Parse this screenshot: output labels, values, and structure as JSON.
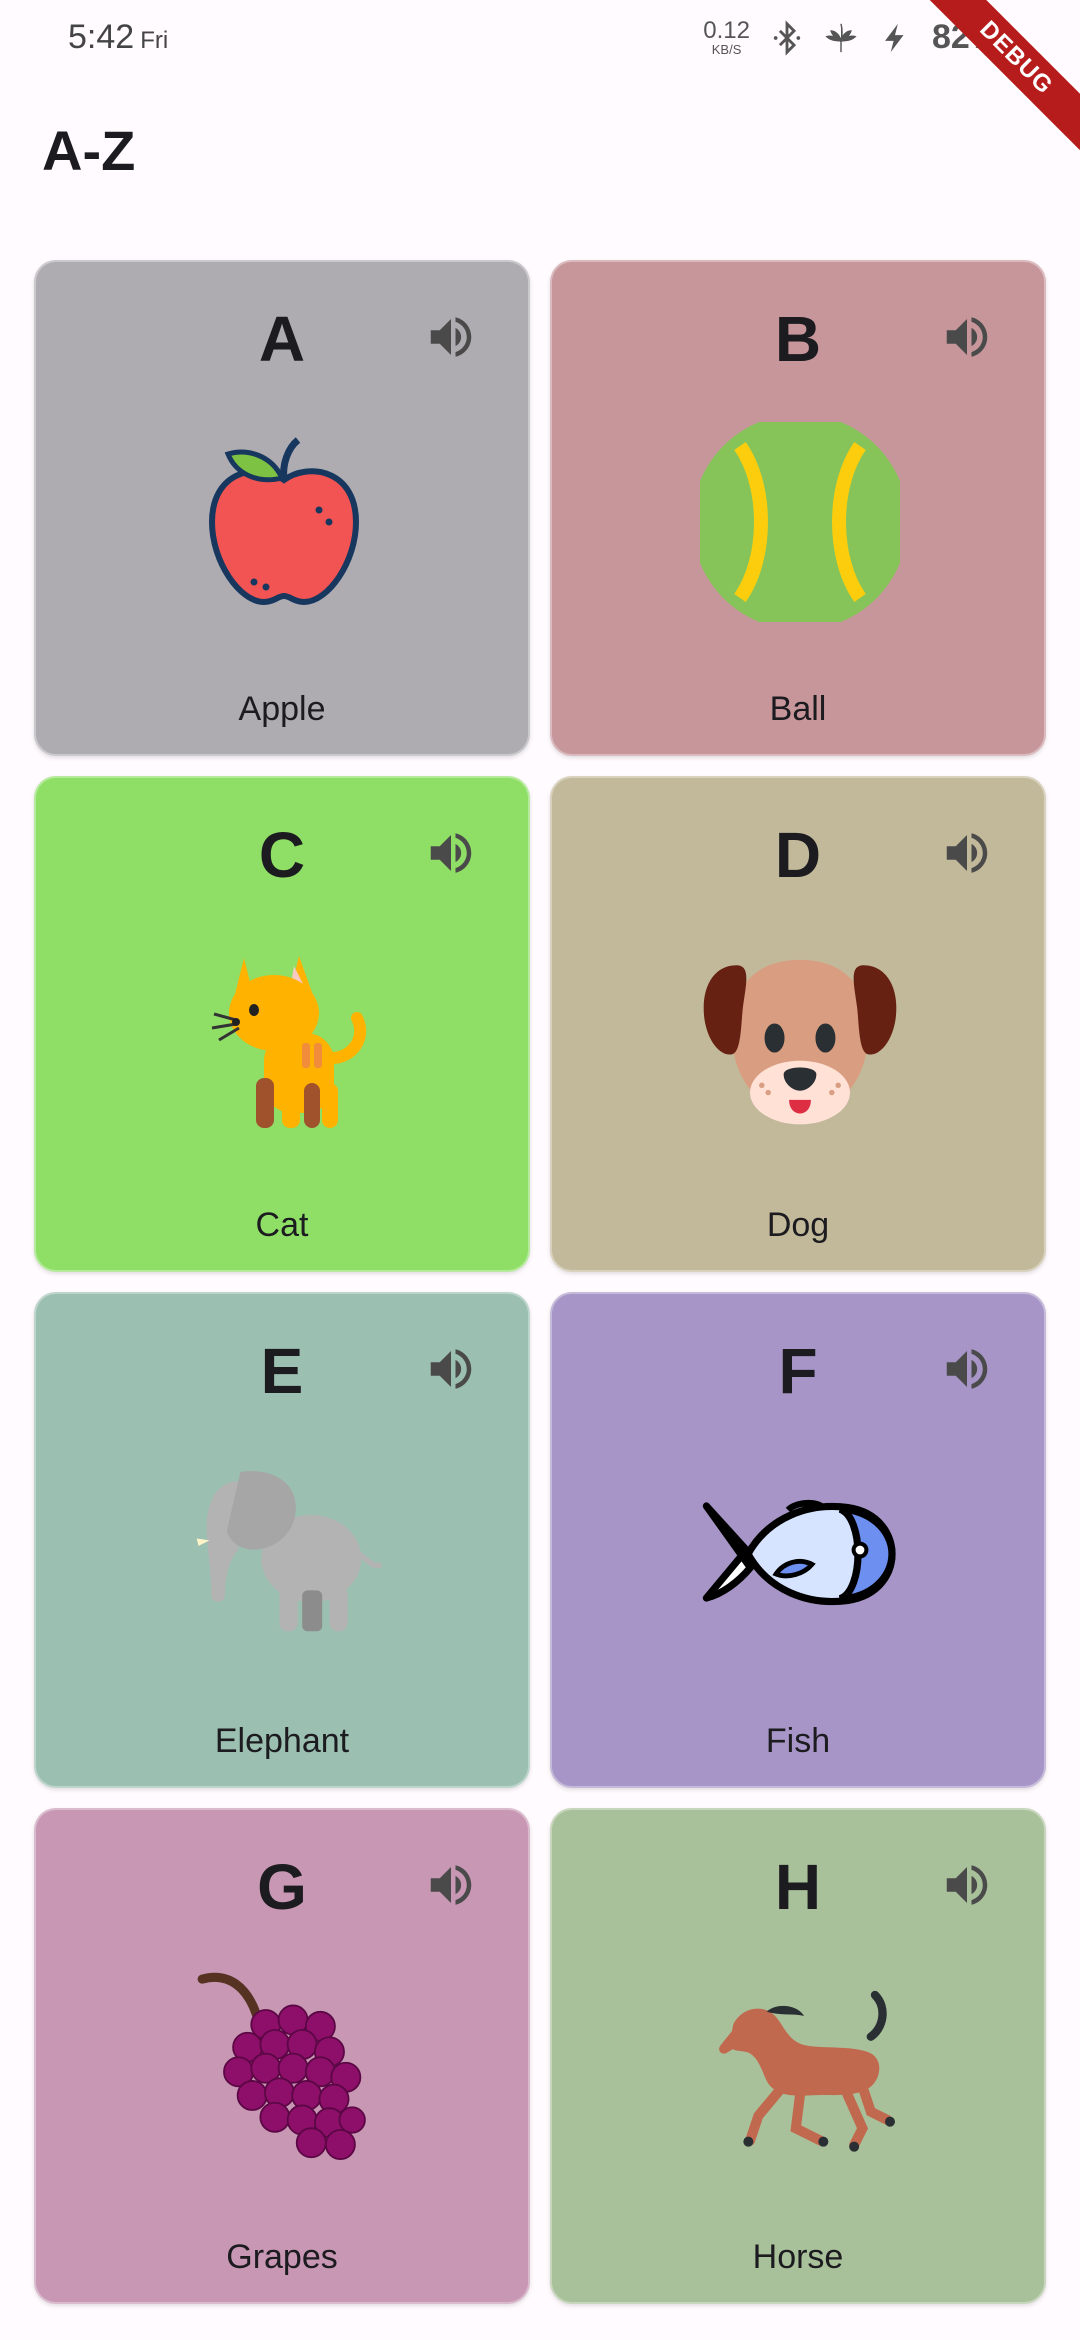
{
  "status_bar": {
    "time": "5:42",
    "day": "Fri",
    "net_speed_value": "0.12",
    "net_speed_unit": "KB/S",
    "battery": "82%"
  },
  "debug_banner": "DEBUG",
  "app_title": "A-Z",
  "cards": [
    {
      "letter": "A",
      "word": "Apple",
      "color": "#aeacb1",
      "icon": "apple-icon"
    },
    {
      "letter": "B",
      "word": "Ball",
      "color": "#c6969b",
      "icon": "ball-icon"
    },
    {
      "letter": "C",
      "word": "Cat",
      "color": "#8fdf67",
      "icon": "cat-icon"
    },
    {
      "letter": "D",
      "word": "Dog",
      "color": "#c2b99a",
      "icon": "dog-icon"
    },
    {
      "letter": "E",
      "word": "Elephant",
      "color": "#9bbfb1",
      "icon": "elephant-icon"
    },
    {
      "letter": "F",
      "word": "Fish",
      "color": "#a695c6",
      "icon": "fish-icon"
    },
    {
      "letter": "G",
      "word": "Grapes",
      "color": "#c797b3",
      "icon": "grapes-icon"
    },
    {
      "letter": "H",
      "word": "Horse",
      "color": "#a9c19a",
      "icon": "horse-icon"
    }
  ]
}
